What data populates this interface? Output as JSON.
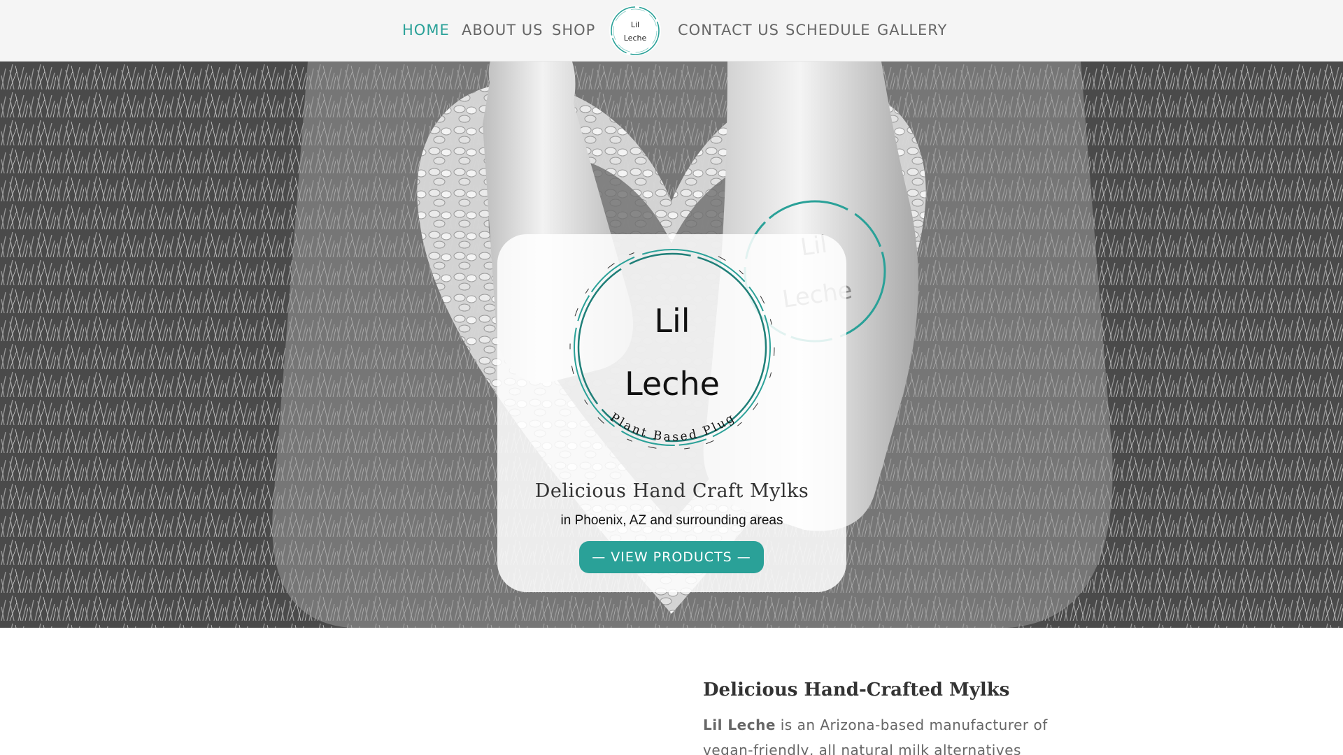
{
  "nav": {
    "items_left": [
      {
        "label": "HOME",
        "active": true
      },
      {
        "label": "ABOUT US",
        "active": false
      },
      {
        "label": "SHOP",
        "active": false
      }
    ],
    "items_right": [
      {
        "label": "CONTACT US",
        "active": false
      },
      {
        "label": "SCHEDULE",
        "active": false
      },
      {
        "label": "GALLERY",
        "active": false
      }
    ],
    "logo": {
      "line1": "Lil",
      "line2": "Leche"
    }
  },
  "hero": {
    "logo": {
      "line1": "Lil",
      "line2": "Leche",
      "ring_text": "Plant Based Plug"
    },
    "title": "Delicious Hand Craft Mylks",
    "subtitle": "in Phoenix, AZ and surrounding areas",
    "button_label": "— VIEW PRODUCTS —"
  },
  "intro": {
    "title": "Delicious Hand-Crafted Mylks",
    "brand": "Lil Leche",
    "text": " is an Arizona-based manufacturer of vegan-friendly, all natural milk alternatives"
  },
  "colors": {
    "accent": "#2aa198",
    "nav_text": "#666666",
    "header_bg": "#f5f5f5"
  }
}
